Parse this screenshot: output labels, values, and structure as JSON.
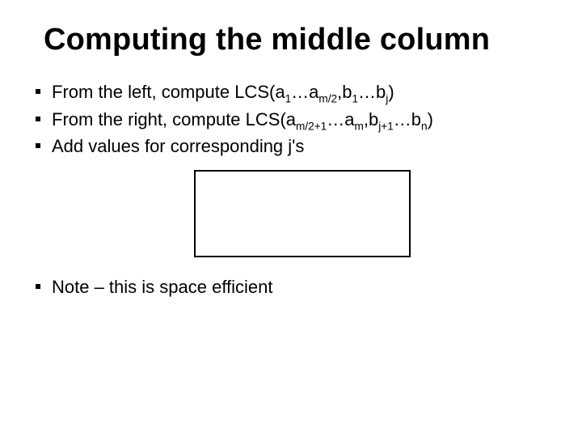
{
  "title": "Computing the middle column",
  "bullets": {
    "b1": {
      "pre": "From the left, compute LCS(a",
      "s1": "1",
      "mid1": "…a",
      "s2": "m/2",
      "mid2": ",b",
      "s3": "1",
      "mid3": "…b",
      "s4": "j",
      "post": ")"
    },
    "b2": {
      "pre": "From the right, compute LCS(a",
      "s1": "m/2+1",
      "mid1": "…a",
      "s2": "m",
      "mid2": ",b",
      "s3": "j+1",
      "mid3": "…b",
      "s4": "n",
      "post": ")"
    },
    "b3": "Add values for corresponding j's",
    "b4": "Note – this is space efficient"
  }
}
